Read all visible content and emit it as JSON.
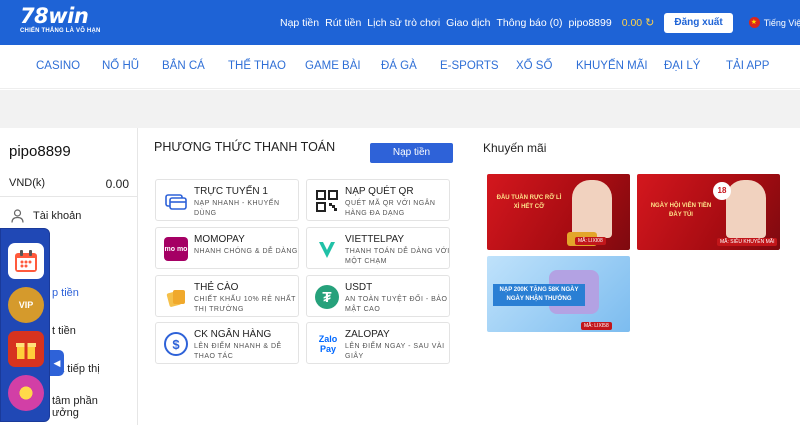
{
  "brand": {
    "name": "78win",
    "tagline": "CHIẾN THẮNG LÀ VÔ HẠN"
  },
  "topnav": {
    "links": [
      "Nạp tiền",
      "Rút tiền",
      "Lịch sử trò chơi",
      "Giao dịch",
      "Thông báo (0)",
      "pipo8899"
    ],
    "balance": "0.00",
    "logout_label": "Đăng xuất",
    "language": "Tiếng Việt"
  },
  "mainnav": [
    "CASINO",
    "NỔ HŨ",
    "BẮN CÁ",
    "THỂ THAO",
    "GAME BÀI",
    "ĐÁ GÀ",
    "E-SPORTS",
    "XỔ SỐ",
    "KHUYẾN MÃI",
    "ĐẠI LÝ",
    "TẢI APP"
  ],
  "sidebar": {
    "username": "pipo8899",
    "currency": "VND(k)",
    "balance": "0.00",
    "items": [
      "Tài khoản",
      "p tiền",
      "t tiền",
      "bá tiếp thị",
      "tâm phần",
      "ưởng"
    ]
  },
  "widget": {
    "vip": "VIP"
  },
  "payment": {
    "title": "PHƯƠNG THỨC THANH TOÁN",
    "deposit_label": "Nạp tiền",
    "methods": [
      {
        "title": "TRỰC TUYẾN 1",
        "desc": "NẠP NHANH - KHUYẾN DÙNG",
        "icon": "card-icon"
      },
      {
        "title": "NẠP QUÉT QR",
        "desc": "QUÉT MÃ QR VỚI NGÂN HÀNG ĐA DẠNG",
        "icon": "qr-icon"
      },
      {
        "title": "MOMOPAY",
        "desc": "NHANH CHÓNG & DỄ DÀNG",
        "icon": "momo-icon",
        "icon_text": "mo mo"
      },
      {
        "title": "VIETTELPAY",
        "desc": "THANH TOÁN DỄ DÀNG VỚI MỘT CHẠM",
        "icon": "viettelpay-icon"
      },
      {
        "title": "THẺ CÀO",
        "desc": "CHIẾT KHẤU 10% RẺ NHẤT THỊ TRƯỜNG",
        "icon": "scratch-card-icon"
      },
      {
        "title": "USDT",
        "desc": "AN TOÀN TUYỆT ĐỐI - BẢO MẬT CAO",
        "icon": "tether-icon",
        "icon_text": "₮"
      },
      {
        "title": "CK NGÂN HÀNG",
        "desc": "LÊN ĐIỂM NHANH & DỄ THAO TÁC",
        "icon": "bank-transfer-icon",
        "icon_text": "$"
      },
      {
        "title": "ZALOPAY",
        "desc": "LÊN ĐIỂM NGAY - SAU VÀI GIÂY",
        "icon": "zalopay-icon",
        "icon_text": "Zalo Pay"
      }
    ]
  },
  "promotions": {
    "title": "Khuyến mãi",
    "banners": [
      {
        "text": "ĐẦU TUẦN RỰC RỠ LÌ XÌ HẾT CỠ",
        "code": "MÃ: LIXI08",
        "color": "#c8141b"
      },
      {
        "text": "NGÀY HỘI VIÊN TIỀN ĐẦY TÚI",
        "code": "MÃ: SIÊU KHUYẾN MÃI",
        "badge": "18",
        "color": "#c8141b"
      },
      {
        "text": "NẠP 200K TẶNG 58K NGÀY NGÀY NHẬN THƯỞNG",
        "code": "MÃ: LIXI58",
        "color": "#5aa8e8"
      }
    ]
  }
}
